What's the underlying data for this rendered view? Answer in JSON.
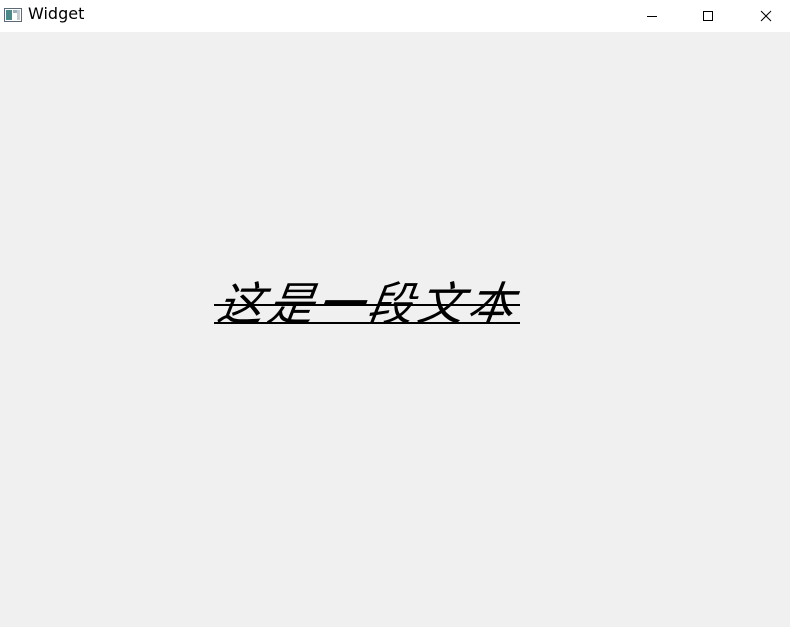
{
  "window": {
    "title": "Widget",
    "icon": "app-window-icon",
    "controls": {
      "minimize": "minimize-icon",
      "maximize": "maximize-icon",
      "close": "close-icon"
    }
  },
  "content": {
    "text": "这是一段文本",
    "style": {
      "italic": true,
      "strikeout": true,
      "underline": true,
      "color": "#000000"
    }
  },
  "colors": {
    "titlebar": "#ffffff",
    "client_background": "#f0f0f0",
    "text": "#000000"
  }
}
